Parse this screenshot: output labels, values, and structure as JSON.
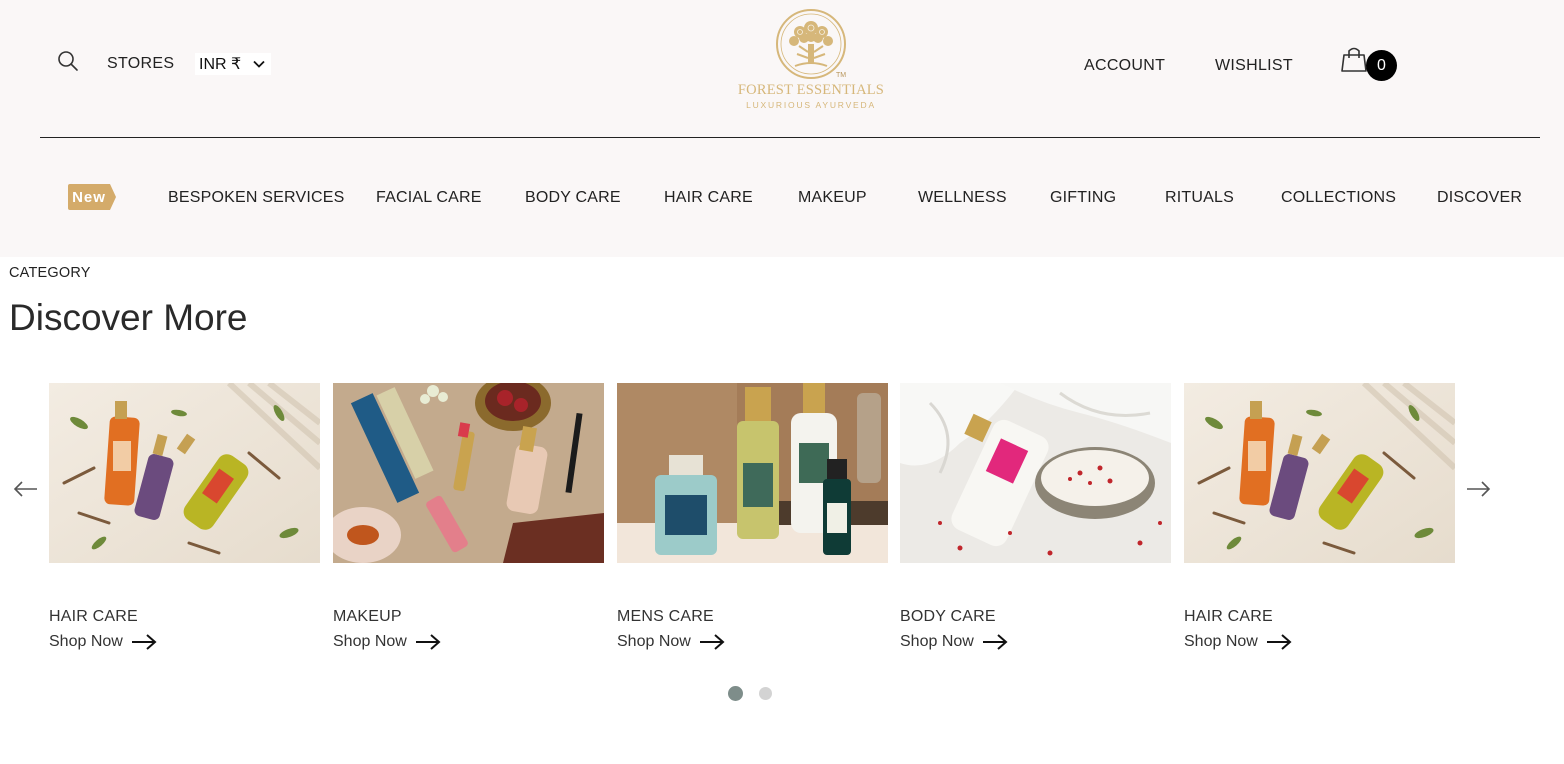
{
  "header": {
    "stores_label": "STORES",
    "currency": "INR ₹",
    "logo_name": "FOREST ESSENTIALS",
    "logo_tagline": "LUXURIOUS AYURVEDA",
    "logo_tm": "TM",
    "account_label": "ACCOUNT",
    "wishlist_label": "WISHLIST",
    "cart_count": "0"
  },
  "nav": {
    "badge": "New",
    "items": [
      "BESPOKEN SERVICES",
      "FACIAL CARE",
      "BODY CARE",
      "HAIR CARE",
      "MAKEUP",
      "WELLNESS",
      "GIFTING",
      "RITUALS",
      "COLLECTIONS",
      "DISCOVER"
    ]
  },
  "section": {
    "category_label": "CATEGORY",
    "title": "Discover More"
  },
  "cards": [
    {
      "category": "HAIR CARE",
      "cta": "Shop Now"
    },
    {
      "category": "MAKEUP",
      "cta": "Shop Now"
    },
    {
      "category": "MENS CARE",
      "cta": "Shop Now"
    },
    {
      "category": "BODY CARE",
      "cta": "Shop Now"
    },
    {
      "category": "HAIR CARE",
      "cta": "Shop Now"
    }
  ],
  "carousel": {
    "active_page": 1,
    "page_count": 2
  },
  "colors": {
    "header_bg": "#faf7f7",
    "brand_gold": "#d6b77a",
    "badge_gold": "#d4ab6a",
    "dot_active": "#7e8d8a",
    "dot_inactive": "#d3d3d3"
  }
}
